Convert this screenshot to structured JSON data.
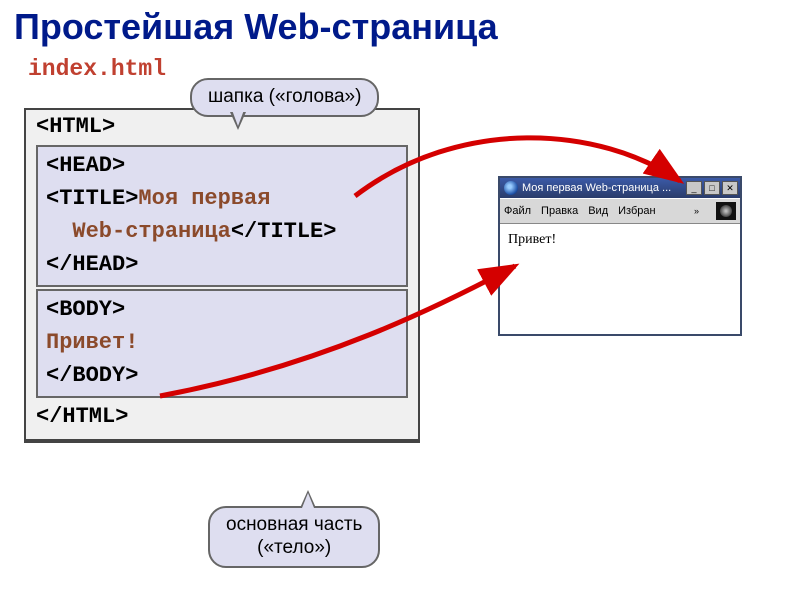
{
  "title": "Простейшая Web-страница",
  "filename": "index.html",
  "code": {
    "html_open": "<HTML>",
    "head_open": "<HEAD>",
    "title_open": "<TITLE>",
    "title_text1": "Моя первая",
    "title_text2": "Web-страница",
    "title_close": "</TITLE>",
    "head_close": "</HEAD>",
    "body_open": "<BODY>",
    "body_text": "Привет!",
    "body_close": "</BODY>",
    "html_close": "</HTML>"
  },
  "callouts": {
    "head": "шапка («голова»)",
    "body_l1": "основная часть",
    "body_l2": "(«тело»)"
  },
  "browser": {
    "title": "Моя первая Web-страница ...",
    "menu": {
      "file": "Файл",
      "edit": "Правка",
      "view": "Вид",
      "fav": "Избран",
      "more": "»"
    },
    "content": "Привет!",
    "btn_min": "_",
    "btn_max": "□",
    "btn_close": "✕"
  }
}
